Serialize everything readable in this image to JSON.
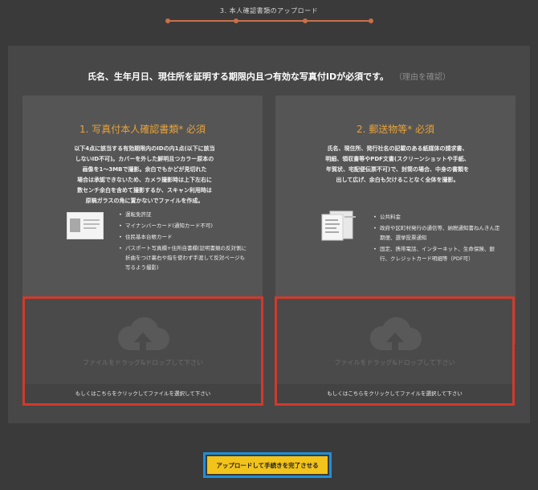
{
  "step": {
    "title": "3. 本人確認書類のアップロード"
  },
  "headline": {
    "text": "氏名、生年月日、現住所を証明する期限内且つ有効な写真付IDが必須です。",
    "reason_link": "（理由を確認）"
  },
  "left_card": {
    "title": "1. 写真付本人確認書類* 必須",
    "description_lines": [
      "以下4点に該当する有効期限内のIDの内1点(以下に該当",
      "しないID不可)。カバーを外した鮮明且つカラー原本の",
      "画像を1～3MBで撮影。余白でもかどが見切れた",
      "場合は承認できないため、カメラ撮影時は上下左右に",
      "数センチ余白を含めて撮影するか、スキャン利用時は",
      "原稿ガラスの角に置かないでファイルを作成。"
    ],
    "bullets": [
      "運転免許証",
      "マイナンバーカード(通知カード不可)",
      "住民基本台帳カード",
      "パスポート写真欄+住所自書欄(証明書類の反対側に折曲をつけ裏右や指を使わず手渡して反対ページも写るよう撮影)"
    ],
    "icon": "id-card-icon"
  },
  "right_card": {
    "title": "2. 郵送物等* 必須",
    "description_lines": [
      "氏名、現住所、発行社名の記載のある紙媒体の請求書、",
      "明細、領収書等やPDF文書(スクリーンショットや手紙、",
      "年賀状、宅配便伝票不可)で、封筒の場合、中身の書類を",
      "出して広げ、余白も欠けることなく全体を撮影。"
    ],
    "bullets": [
      "公共料金",
      "政府や区町村発行の通信等、納税通知書ねんきん定期便、選挙投票通知",
      "固定、携帯電話、インターネット、生命保険、銀行、クレジットカード明細等（PDF可）"
    ],
    "icon": "documents-icon"
  },
  "dropzone": {
    "drop_text": "ファイルをドラッグ&ドロップして下さい",
    "select_text": "もしくはこちらをクリックしてファイルを選択して下さい",
    "icon": "cloud-upload-icon"
  },
  "submit": {
    "label": "アップロードして手続きを完了させる"
  },
  "colors": {
    "background": "#3a3a3a",
    "panel": "#474747",
    "card": "#555555",
    "accent_orange": "#e8a33a",
    "step_line": "#c8704a",
    "highlight_red": "#d13a2c",
    "highlight_blue": "#1f8fd6",
    "button_yellow": "#f2c31a"
  }
}
